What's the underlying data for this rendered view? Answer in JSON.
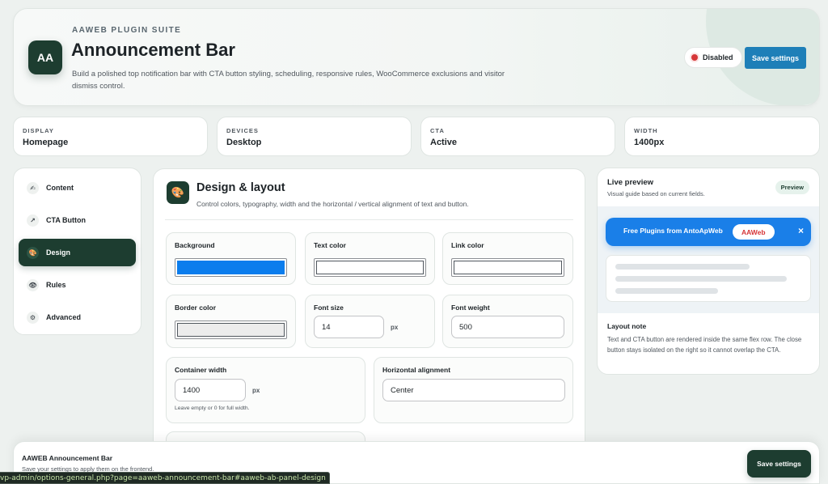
{
  "header": {
    "suite": "AAWEB PLUGIN SUITE",
    "logo_text": "AA",
    "title": "Announcement Bar",
    "description": "Build a polished top notification bar with CTA button styling, scheduling, responsive rules, WooCommerce exclusions and visitor dismiss control.",
    "status_label": "Disabled",
    "save_label": "Save settings"
  },
  "stats": [
    {
      "label": "DISPLAY",
      "value": "Homepage"
    },
    {
      "label": "DEVICES",
      "value": "Desktop"
    },
    {
      "label": "CTA",
      "value": "Active"
    },
    {
      "label": "WIDTH",
      "value": "1400px"
    }
  ],
  "sidebar": {
    "items": [
      {
        "label": "Content",
        "icon": "✍"
      },
      {
        "label": "CTA Button",
        "icon": "↗"
      },
      {
        "label": "Design",
        "icon": "🎨"
      },
      {
        "label": "Rules",
        "icon": "👁"
      },
      {
        "label": "Advanced",
        "icon": "⚙"
      }
    ],
    "active_index": 2
  },
  "section": {
    "icon": "🎨",
    "title": "Design & layout",
    "description": "Control colors, typography, width and the horizontal / vertical alignment of text and button.",
    "fields": {
      "background": {
        "label": "Background",
        "color": "#0b7ded"
      },
      "text_color": {
        "label": "Text color",
        "color": "#ffffff"
      },
      "link_color": {
        "label": "Link color",
        "color": "#ffffff"
      },
      "border_color": {
        "label": "Border color",
        "color": "#ececec"
      },
      "font_size": {
        "label": "Font size",
        "value": "14",
        "unit": "px"
      },
      "font_weight": {
        "label": "Font weight",
        "value": "500"
      },
      "container_width": {
        "label": "Container width",
        "value": "1400",
        "unit": "px",
        "help": "Leave empty or 0 for full width."
      },
      "horizontal_alignment": {
        "label": "Horizontal alignment",
        "value": "Center"
      }
    }
  },
  "preview": {
    "title": "Live preview",
    "subtitle": "Visual guide based on current fields.",
    "badge": "Preview",
    "bar_text": "Free Plugins from AntoApWeb",
    "cta_text": "AAWeb",
    "close_glyph": "×",
    "note_title": "Layout note",
    "note_text": "Text and CTA button are rendered inside the same flex row. The close button stays isolated on the right so it cannot overlap the CTA."
  },
  "footer": {
    "title": "AAWEB Announcement Bar",
    "subtitle": "Save your settings to apply them on the frontend.",
    "save_label": "Save settings"
  },
  "status_bar_url": "vp-admin/options-general.php?page=aaweb-announcement-bar#aaweb-ab-panel-design",
  "colors": {
    "brand_dark": "#1d3d30",
    "wp_blue": "#1e7fb8",
    "preview_bar": "#1a7fe8",
    "disabled_red": "#d63638"
  }
}
